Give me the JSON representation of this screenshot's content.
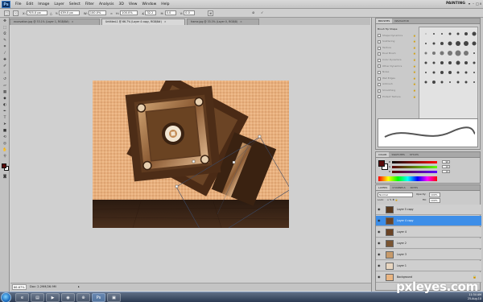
{
  "menubar": {
    "logo": "Ps",
    "items": [
      "File",
      "Edit",
      "Image",
      "Layer",
      "Select",
      "Filter",
      "Analysis",
      "3D",
      "View",
      "Window",
      "Help"
    ],
    "workspace": "PAINTING"
  },
  "options": {
    "x_label": "X:",
    "x_value": "705.0 px",
    "y_label": "Y:",
    "y_value": "439.0 px",
    "w_label": "W:",
    "w_value": "100.0%",
    "h_label": "H:",
    "h_value": "100.0%",
    "angle_value": "32.2",
    "hskew_label": "H:",
    "hskew_value": "0.0",
    "vskew_label": "V:",
    "vskew_value": "0.0"
  },
  "tabs": [
    {
      "label": "excavation.jpg @ 33.1% (Layer 1, RGB/8#)",
      "active": false
    },
    {
      "label": "Untitled-1 @ 66.7% (Layer 4 copy, RGB/8#)",
      "active": true
    },
    {
      "label": "frame.jpg @ 33.3% (Layer 0, RGB/8)",
      "active": false
    }
  ],
  "panels": {
    "brushes_tabs": [
      "Brushes",
      "Navigator"
    ],
    "brush_settings": [
      "Brush Tip Shape",
      "Shape Dynamics",
      "Scattering",
      "Texture",
      "Dual Brush",
      "Color Dynamics",
      "Other Dynamics",
      "Noise",
      "Wet Edges",
      "Airbrush",
      "Smoothing",
      "Protect Texture"
    ],
    "brush_spacing": "Spacing",
    "color_tabs": [
      "Color",
      "Swatches",
      "Styles"
    ],
    "color_channels": [
      {
        "label": "R",
        "value": "90"
      },
      {
        "label": "G",
        "value": "10"
      },
      {
        "label": "B",
        "value": "10"
      }
    ],
    "layers_tabs": [
      "Layers",
      "Channels",
      "Paths"
    ],
    "blend_mode": "Normal",
    "opacity_label": "Opacity:",
    "opacity_value": "100%",
    "lock_label": "Lock:",
    "fill_label": "Fill:",
    "fill_value": "100%",
    "layers": [
      {
        "name": "Layer 5 copy",
        "active": false,
        "thumb": "#5b3a1e"
      },
      {
        "name": "Layer 4 copy",
        "active": true,
        "thumb": "#6b4425"
      },
      {
        "name": "Layer 4",
        "active": false,
        "thumb": "#6b4425"
      },
      {
        "name": "Layer 2",
        "active": false,
        "thumb": "#7a5533"
      },
      {
        "name": "Layer 3",
        "active": false,
        "thumb": "#c79a6a"
      },
      {
        "name": "Layer 1",
        "active": false,
        "thumb": "#e8d6c0"
      },
      {
        "name": "Background",
        "active": false,
        "thumb": "#e9b582"
      }
    ]
  },
  "status": {
    "zoom": "66.67%",
    "doc": "Doc: 2.29M/26.9M"
  },
  "taskbar": {
    "time": "11:34 AM",
    "date": "25-Aug-10"
  },
  "watermark": "pxleyes.com",
  "colors": {
    "foreground": "#5a0a0a",
    "background": "#ffffff",
    "selected_layer": "#3d8ee8"
  }
}
